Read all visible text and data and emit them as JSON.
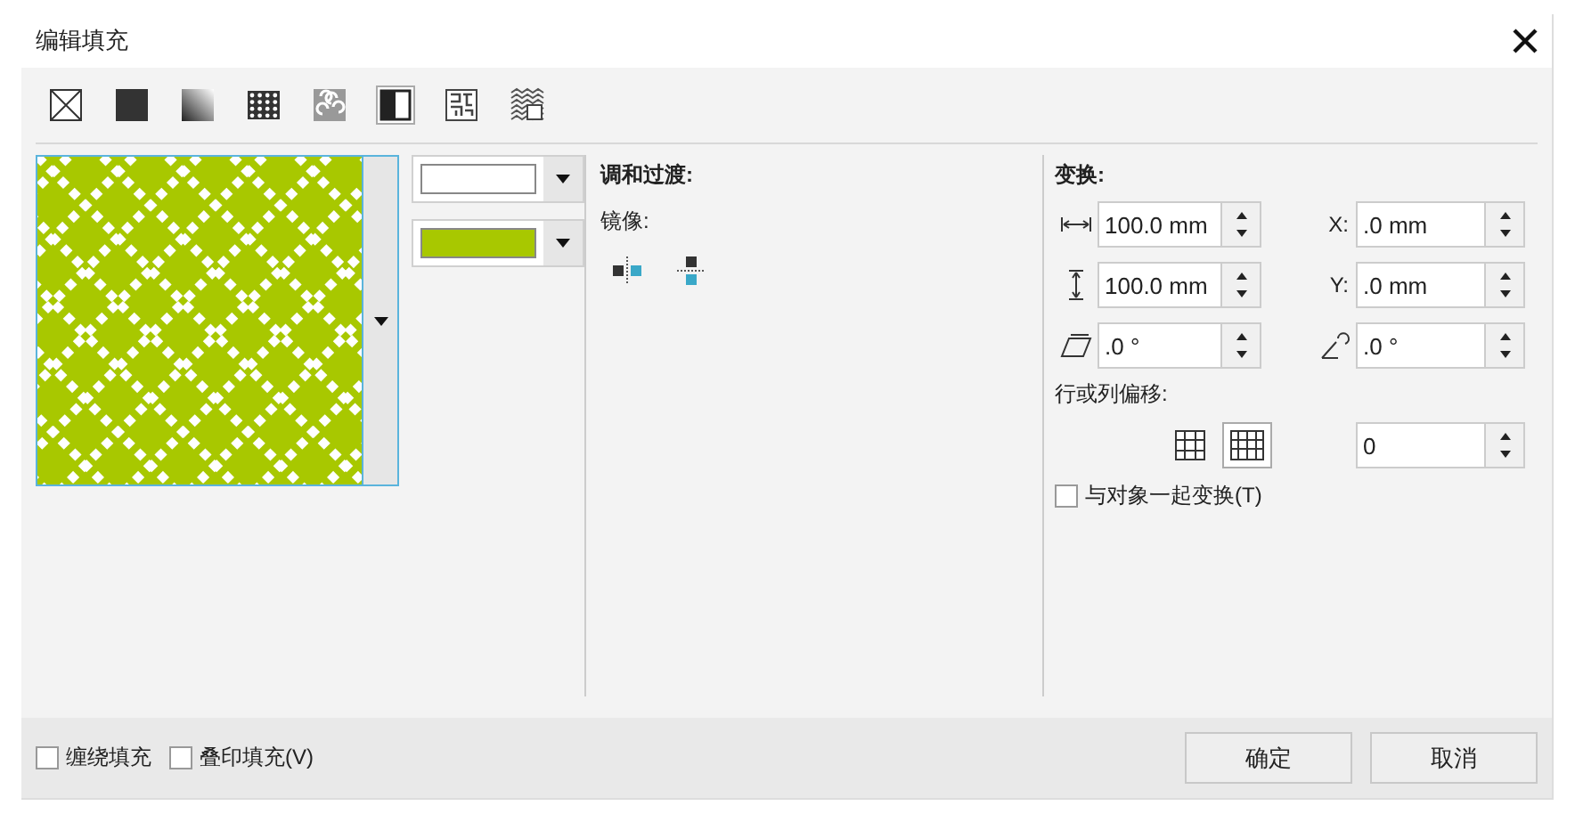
{
  "window": {
    "title": "编辑填充"
  },
  "fill_types": [
    {
      "kind": "none",
      "selected": false
    },
    {
      "kind": "uniform",
      "selected": false
    },
    {
      "kind": "gradient",
      "selected": false
    },
    {
      "kind": "vector",
      "selected": false
    },
    {
      "kind": "bitmap",
      "selected": false
    },
    {
      "kind": "two_color",
      "selected": true
    },
    {
      "kind": "texture",
      "selected": false
    },
    {
      "kind": "postscript",
      "selected": false
    }
  ],
  "pattern": {
    "colors": [
      {
        "color": "#ffffff"
      },
      {
        "color": "#a8c800"
      }
    ]
  },
  "blend": {
    "title": "调和过渡:",
    "mirror_label": "镜像:",
    "mirror_buttons": [
      {
        "kind": "horizontal",
        "selected": false
      },
      {
        "kind": "vertical",
        "selected": false
      }
    ]
  },
  "transform": {
    "title": "变换:",
    "fields": [
      {
        "kind": "width",
        "value": "100.0 mm"
      },
      {
        "kind": "x",
        "label": "X:",
        "value": ".0 mm"
      },
      {
        "kind": "height",
        "value": "100.0 mm"
      },
      {
        "kind": "y",
        "label": "Y:",
        "value": ".0 mm"
      },
      {
        "kind": "skew",
        "value": ".0 °"
      },
      {
        "kind": "rotate",
        "value": ".0 °"
      }
    ],
    "offset_label": "行或列偏移:",
    "offset_modes": [
      {
        "kind": "row",
        "selected": false
      },
      {
        "kind": "column",
        "selected": true
      }
    ],
    "offset_value": "0",
    "with_object": {
      "label": "与对象一起变换(T)",
      "checked": false
    }
  },
  "footer": {
    "options": [
      {
        "label": "缠绕填充",
        "checked": false
      },
      {
        "label": "叠印填充(V)",
        "checked": false
      }
    ],
    "buttons": [
      "确定",
      "取消"
    ]
  }
}
